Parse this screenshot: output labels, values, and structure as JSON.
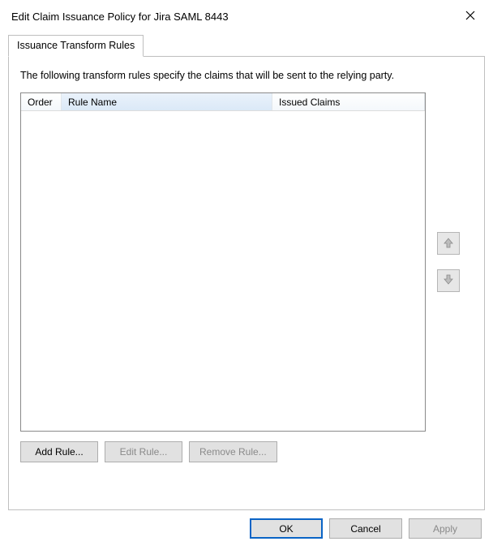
{
  "window": {
    "title": "Edit Claim Issuance Policy for Jira SAML 8443"
  },
  "tabs": {
    "issuance_transform": "Issuance Transform Rules"
  },
  "panel": {
    "description": "The following transform rules specify the claims that will be sent to the relying party.",
    "columns": {
      "order": "Order",
      "rule_name": "Rule Name",
      "issued_claims": "Issued Claims"
    },
    "rows": []
  },
  "buttons": {
    "add_rule": "Add Rule...",
    "edit_rule": "Edit Rule...",
    "remove_rule": "Remove Rule...",
    "ok": "OK",
    "cancel": "Cancel",
    "apply": "Apply"
  }
}
